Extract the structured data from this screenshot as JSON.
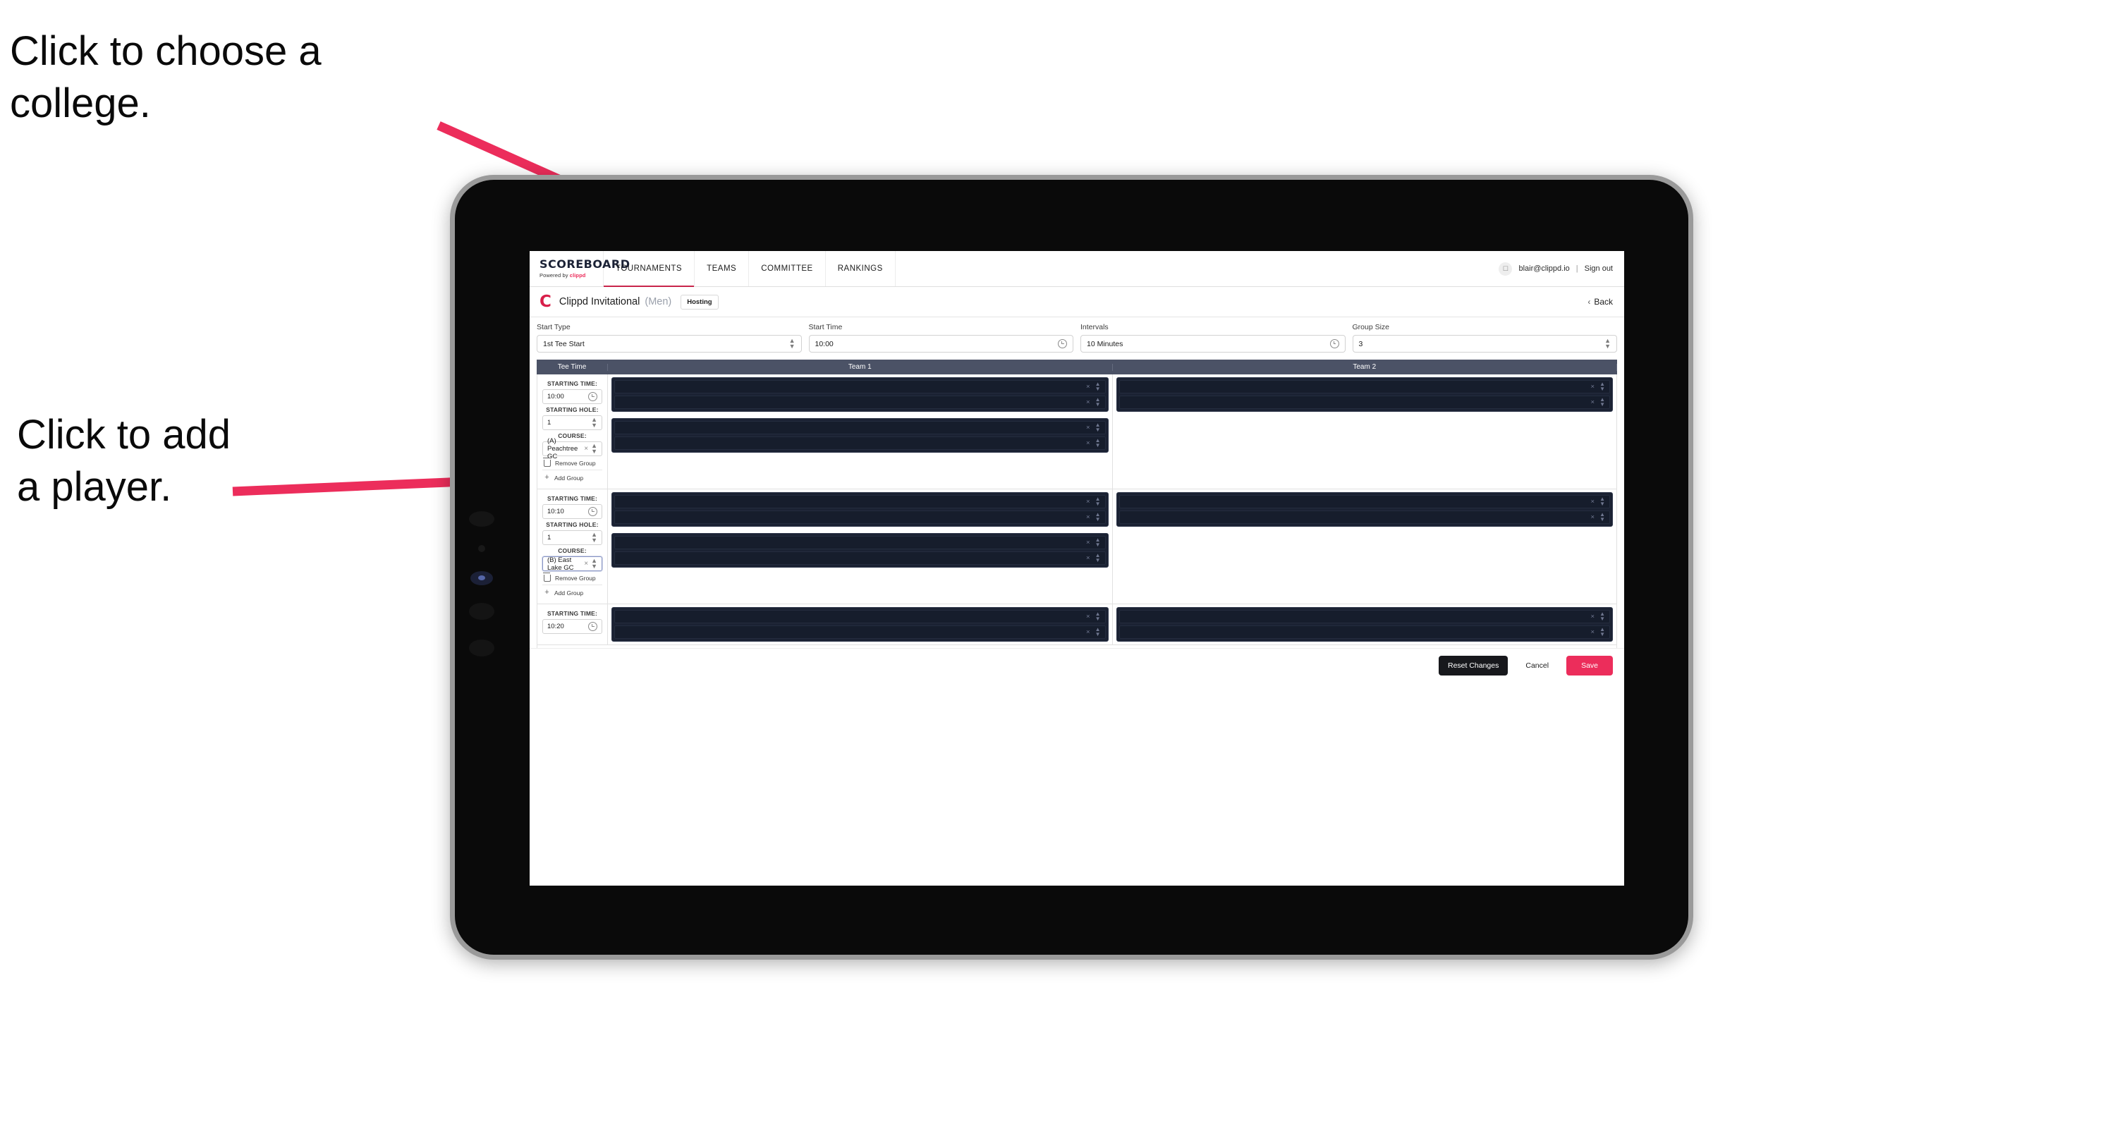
{
  "annotations": {
    "choose_college": "Click to choose a\ncollege.",
    "add_player": "Click to add\na player."
  },
  "colors": {
    "accent_pink": "#ec2d5b",
    "brand_red": "#d81f4a",
    "table_header": "#4b5266",
    "slot_dark": "#1b2233",
    "dark_button": "#17181c"
  },
  "nav": {
    "brand_main": "SCOREBOARD",
    "brand_sub_prefix": "Powered by ",
    "brand_sub_name": "clippd",
    "tabs": [
      {
        "label": "TOURNAMENTS",
        "active": true
      },
      {
        "label": "TEAMS",
        "active": false
      },
      {
        "label": "COMMITTEE",
        "active": false
      },
      {
        "label": "RANKINGS",
        "active": false
      }
    ],
    "account": {
      "avatar_icon": "user-avatar-icon",
      "email": "blair@clippd.io",
      "separator": "|",
      "sign_out": "Sign out"
    }
  },
  "title_bar": {
    "logo_letter": "C",
    "tournament_name": "Clippd Invitational",
    "gender": "(Men)",
    "badge": "Hosting",
    "back_chevron": "‹",
    "back_label": "Back"
  },
  "settings": {
    "fields": [
      {
        "label": "Start Type",
        "value": "1st Tee Start",
        "icon": "spinner"
      },
      {
        "label": "Start Time",
        "value": "10:00",
        "icon": "clock"
      },
      {
        "label": "Intervals",
        "value": "10 Minutes",
        "icon": "clock"
      },
      {
        "label": "Group Size",
        "value": "3",
        "icon": "spinner"
      }
    ]
  },
  "table": {
    "headers": {
      "tee_time": "Tee Time",
      "team1": "Team 1",
      "team2": "Team 2"
    },
    "labels": {
      "starting_time": "STARTING TIME:",
      "starting_hole": "STARTING HOLE:",
      "course": "COURSE:",
      "remove_group": "Remove Group",
      "add_group": "Add Group",
      "clear_icon": "×",
      "spin_icon": "spinner"
    },
    "rows": [
      {
        "starting_time": "10:00",
        "starting_hole": "1",
        "course": "(A) Peachtree GC",
        "course_focused": false,
        "team1_blocks": [
          [
            "",
            ""
          ],
          [
            "",
            ""
          ]
        ],
        "team2_blocks": [
          [
            "",
            ""
          ]
        ]
      },
      {
        "starting_time": "10:10",
        "starting_hole": "1",
        "course": "(B) East Lake GC",
        "course_focused": true,
        "team1_blocks": [
          [
            "",
            ""
          ],
          [
            "",
            ""
          ]
        ],
        "team2_blocks": [
          [
            "",
            ""
          ]
        ]
      },
      {
        "starting_time": "10:20",
        "starting_hole": "",
        "course": "",
        "course_focused": false,
        "team1_blocks": [
          [
            "",
            ""
          ]
        ],
        "team2_blocks": [
          [
            "",
            ""
          ]
        ]
      }
    ]
  },
  "footer": {
    "reset": "Reset Changes",
    "cancel": "Cancel",
    "save": "Save"
  }
}
